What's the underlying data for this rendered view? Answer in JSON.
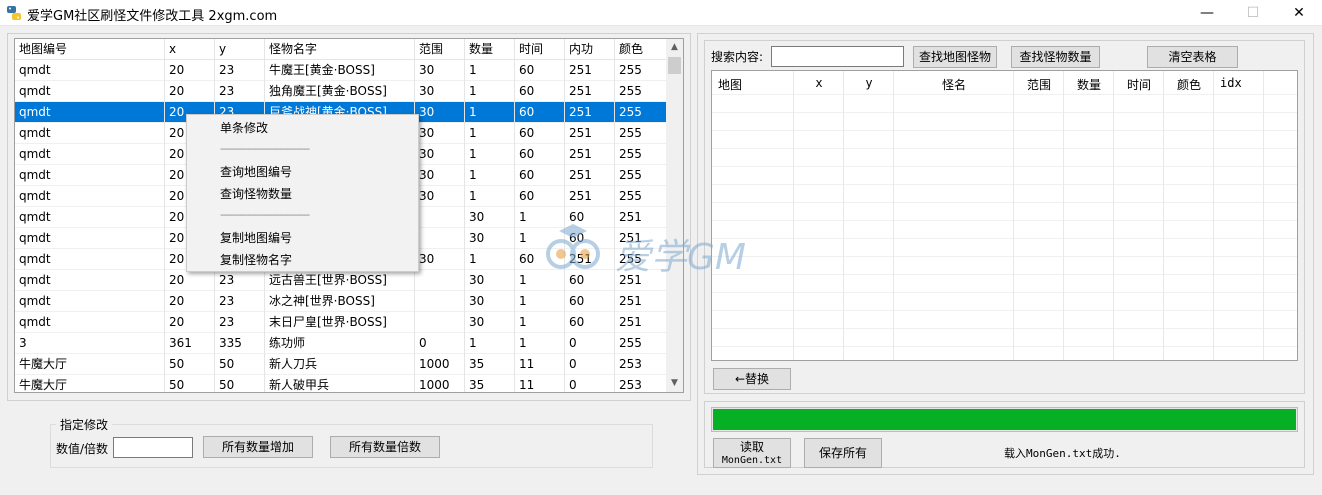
{
  "window": {
    "title": "爱学GM社区刷怪文件修改工具 2xgm.com",
    "minimize_glyph": "—",
    "maximize_glyph": "☐",
    "close_glyph": "✕"
  },
  "left_table": {
    "columns": [
      "地图编号",
      "x",
      "y",
      "怪物名字",
      "范围",
      "数量",
      "时间",
      "内功",
      "颜色"
    ],
    "rows": [
      [
        "qmdt",
        "20",
        "23",
        "牛魔王[黄金·BOSS]",
        "30",
        "1",
        "60",
        "251",
        "255"
      ],
      [
        "qmdt",
        "20",
        "23",
        "独角魔王[黄金·BOSS]",
        "30",
        "1",
        "60",
        "251",
        "255"
      ],
      [
        "qmdt",
        "20",
        "23",
        "巨斧战神[黄金·BOSS]",
        "30",
        "1",
        "60",
        "251",
        "255"
      ],
      [
        "qmdt",
        "20",
        "",
        "",
        "30",
        "1",
        "60",
        "251",
        "255"
      ],
      [
        "qmdt",
        "20",
        "",
        "",
        "30",
        "1",
        "60",
        "251",
        "255"
      ],
      [
        "qmdt",
        "20",
        "",
        "",
        "30",
        "1",
        "60",
        "251",
        "255"
      ],
      [
        "qmdt",
        "20",
        "",
        "",
        "30",
        "1",
        "60",
        "251",
        "255"
      ],
      [
        "qmdt",
        "20",
        "",
        "",
        "",
        "30",
        "1",
        "60",
        "251"
      ],
      [
        "qmdt",
        "20",
        "",
        "",
        "",
        "30",
        "1",
        "60",
        "251"
      ],
      [
        "qmdt",
        "20",
        "",
        "",
        "30",
        "1",
        "60",
        "251",
        "255"
      ],
      [
        "qmdt",
        "20",
        "23",
        "远古兽王[世界·BOSS]",
        "",
        "30",
        "1",
        "60",
        "251"
      ],
      [
        "qmdt",
        "20",
        "23",
        "冰之神[世界·BOSS]",
        "",
        "30",
        "1",
        "60",
        "251"
      ],
      [
        "qmdt",
        "20",
        "23",
        "末日尸皇[世界·BOSS]",
        "",
        "30",
        "1",
        "60",
        "251"
      ],
      [
        "3",
        "361",
        "335",
        "练功师",
        "0",
        "1",
        "1",
        "0",
        "255"
      ],
      [
        "牛魔大厅",
        "50",
        "50",
        "新人刀兵",
        "1000",
        "35",
        "11",
        "0",
        "253"
      ],
      [
        "牛魔大厅",
        "50",
        "50",
        "新人破甲兵",
        "1000",
        "35",
        "11",
        "0",
        "253"
      ]
    ],
    "selected_row": 2
  },
  "context_menu": {
    "items": [
      "单条修改",
      "查询地图编号",
      "查询怪物数量",
      "复制地图编号",
      "复制怪物名字"
    ],
    "separator": "------------------------------"
  },
  "modify_group": {
    "title": "指定修改",
    "value_label": "数值/倍数",
    "value_input": "",
    "increase_button": "所有数量增加",
    "multiply_button": "所有数量倍数"
  },
  "search": {
    "label": "搜索内容:",
    "input_value": "",
    "find_monster_button": "查找地图怪物",
    "find_count_button": "查找怪物数量",
    "clear_button": "清空表格"
  },
  "right_table": {
    "columns": [
      "地图",
      "x",
      "y",
      "怪名",
      "范围",
      "数量",
      "时间",
      "颜色",
      "idx"
    ]
  },
  "replace_button": "←替换",
  "progress": {
    "value_percent": 100,
    "color": "#06b025"
  },
  "bottom": {
    "read_button_line1": "读取",
    "read_button_line2": "MonGen.txt",
    "save_button": "保存所有",
    "status": "载入MonGen.txt成功."
  },
  "watermark": {
    "text": "爱学GM"
  }
}
